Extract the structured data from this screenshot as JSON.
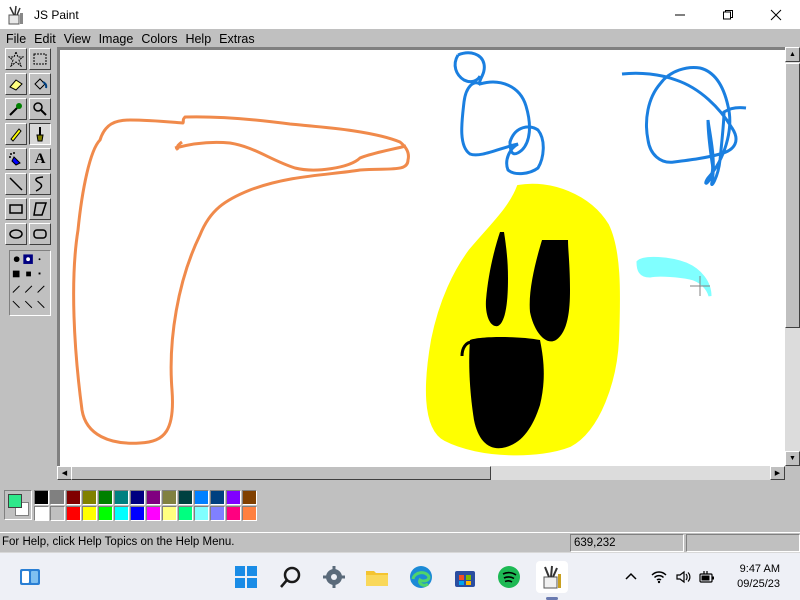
{
  "window": {
    "title": "JS Paint"
  },
  "menu": [
    "File",
    "Edit",
    "View",
    "Image",
    "Colors",
    "Help",
    "Extras"
  ],
  "tools": [
    {
      "name": "free-form-select-tool",
      "icon": "star-select"
    },
    {
      "name": "select-tool",
      "icon": "rect-select"
    },
    {
      "name": "eraser-tool",
      "icon": "eraser"
    },
    {
      "name": "fill-tool",
      "icon": "paint-bucket"
    },
    {
      "name": "pick-color-tool",
      "icon": "eyedropper"
    },
    {
      "name": "magnifier-tool",
      "icon": "magnifier"
    },
    {
      "name": "pencil-tool",
      "icon": "pencil"
    },
    {
      "name": "brush-tool",
      "icon": "brush"
    },
    {
      "name": "airbrush-tool",
      "icon": "airbrush"
    },
    {
      "name": "text-tool",
      "icon": "text",
      "label": "A"
    },
    {
      "name": "line-tool",
      "icon": "line"
    },
    {
      "name": "curve-tool",
      "icon": "curve"
    },
    {
      "name": "rectangle-tool",
      "icon": "rectangle"
    },
    {
      "name": "polygon-tool",
      "icon": "polygon"
    },
    {
      "name": "ellipse-tool",
      "icon": "ellipse"
    },
    {
      "name": "rounded-rectangle-tool",
      "icon": "rounded-rectangle"
    }
  ],
  "palette": {
    "primary": "#2ee88a",
    "secondary": "#ffffff",
    "top_row": [
      "#000000",
      "#808080",
      "#800000",
      "#808000",
      "#008000",
      "#008080",
      "#000080",
      "#800080",
      "#808040",
      "#004040",
      "#0080ff",
      "#004080",
      "#8000ff",
      "#804000"
    ],
    "bottom_row": [
      "#ffffff",
      "#c0c0c0",
      "#ff0000",
      "#ffff00",
      "#00ff00",
      "#00ffff",
      "#0000ff",
      "#ff00ff",
      "#ffff80",
      "#00ff80",
      "#80ffff",
      "#8080ff",
      "#ff0080",
      "#ff8040"
    ]
  },
  "status": {
    "help_text": "For Help, click Help Topics on the Help Menu.",
    "coordinates": "639,232",
    "size": ""
  },
  "taskbar": {
    "time": "9:47 AM",
    "date": "09/25/23"
  }
}
